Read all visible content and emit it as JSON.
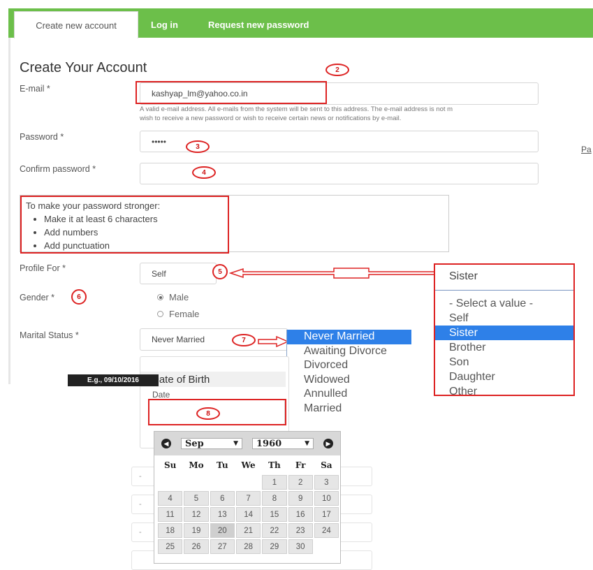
{
  "tabs": [
    {
      "label": "Create new account"
    },
    {
      "label": "Log in"
    },
    {
      "label": "Request new password"
    }
  ],
  "page_title": "Create Your Account",
  "email": {
    "label": "E-mail *",
    "value": "kashyap_lm@yahoo.co.in",
    "help_line1": "A valid e-mail address. All e-mails from the system will be sent to this address. The e-mail address is not m",
    "help_line2": "wish to receive a new password or wish to receive certain news or notifications by e-mail."
  },
  "password": {
    "label": "Password *",
    "value": "•••••",
    "side_link": "Pa"
  },
  "confirm_password": {
    "label": "Confirm password *",
    "value": ""
  },
  "password_tips": {
    "title": "To make your password stronger:",
    "items": [
      "Make it at least 6 characters",
      "Add numbers",
      "Add punctuation"
    ]
  },
  "profile_for": {
    "label": "Profile For *",
    "value": "Self"
  },
  "gender": {
    "label": "Gender *",
    "options": [
      "Male",
      "Female"
    ],
    "selected": "Male"
  },
  "marital_status": {
    "label": "Marital Status *",
    "value": "Never Married"
  },
  "marital_options": [
    "Never Married",
    "Awaiting Divorce",
    "Divorced",
    "Widowed",
    "Annulled",
    "Married"
  ],
  "marital_selected": "Never Married",
  "profile_dropdown": {
    "current": "Sister",
    "options": [
      "- Select a value -",
      "Self",
      "Sister",
      "Brother",
      "Son",
      "Daughter",
      "Other"
    ],
    "selected": "Sister"
  },
  "dob": {
    "tooltip": "E.g., 09/10/2016",
    "heading": "Date of Birth",
    "date_label": "Date",
    "value": ""
  },
  "calendar": {
    "month": "Sep",
    "year": "1960",
    "weekdays": [
      "Su",
      "Mo",
      "Tu",
      "We",
      "Th",
      "Fr",
      "Sa"
    ],
    "weeks": [
      [
        "",
        "",
        "",
        "",
        "1",
        "2",
        "3"
      ],
      [
        "4",
        "5",
        "6",
        "7",
        "8",
        "9",
        "10"
      ],
      [
        "11",
        "12",
        "13",
        "14",
        "15",
        "16",
        "17"
      ],
      [
        "18",
        "19",
        "20",
        "21",
        "22",
        "23",
        "24"
      ],
      [
        "25",
        "26",
        "27",
        "28",
        "29",
        "30",
        ""
      ]
    ],
    "today": "20"
  },
  "annotations": [
    "2",
    "3",
    "4",
    "5",
    "6",
    "7",
    "8"
  ],
  "colors": {
    "tab_green": "#6cbf4a",
    "annotation_red": "#d22",
    "selection_blue": "#2e80e8"
  }
}
